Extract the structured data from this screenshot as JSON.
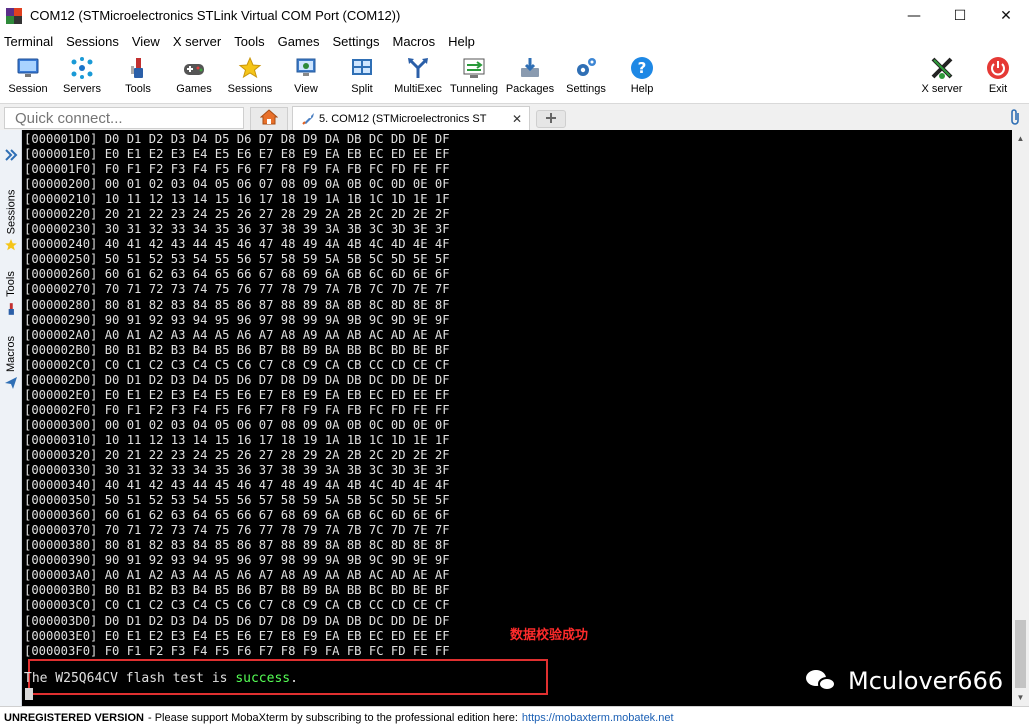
{
  "window": {
    "title": "COM12  (STMicroelectronics STLink Virtual COM Port (COM12))",
    "minimize": "—",
    "maximize": "☐",
    "close": "✕"
  },
  "menu": [
    "Terminal",
    "Sessions",
    "View",
    "X server",
    "Tools",
    "Games",
    "Settings",
    "Macros",
    "Help"
  ],
  "toolbar": [
    {
      "label": "Session",
      "icon": "session-icon"
    },
    {
      "label": "Servers",
      "icon": "servers-icon"
    },
    {
      "label": "Tools",
      "icon": "tools-icon"
    },
    {
      "label": "Games",
      "icon": "games-icon"
    },
    {
      "label": "Sessions",
      "icon": "star-icon"
    },
    {
      "label": "View",
      "icon": "view-icon"
    },
    {
      "label": "Split",
      "icon": "split-icon"
    },
    {
      "label": "MultiExec",
      "icon": "multiexec-icon"
    },
    {
      "label": "Tunneling",
      "icon": "tunneling-icon"
    },
    {
      "label": "Packages",
      "icon": "packages-icon"
    },
    {
      "label": "Settings",
      "icon": "settings-icon"
    },
    {
      "label": "Help",
      "icon": "help-icon"
    },
    {
      "label": "X server",
      "icon": "xserver-icon"
    },
    {
      "label": "Exit",
      "icon": "power-icon"
    }
  ],
  "quick_connect": {
    "placeholder": "Quick connect..."
  },
  "tab": {
    "label": "5. COM12  (STMicroelectronics ST",
    "close": "✕"
  },
  "side_panel": {
    "sessions": "Sessions",
    "tools": "Tools",
    "macros": "Macros"
  },
  "terminal": {
    "lines": [
      "[000001D0] D0 D1 D2 D3 D4 D5 D6 D7 D8 D9 DA DB DC DD DE DF",
      "[000001E0] E0 E1 E2 E3 E4 E5 E6 E7 E8 E9 EA EB EC ED EE EF",
      "[000001F0] F0 F1 F2 F3 F4 F5 F6 F7 F8 F9 FA FB FC FD FE FF",
      "[00000200] 00 01 02 03 04 05 06 07 08 09 0A 0B 0C 0D 0E 0F",
      "[00000210] 10 11 12 13 14 15 16 17 18 19 1A 1B 1C 1D 1E 1F",
      "[00000220] 20 21 22 23 24 25 26 27 28 29 2A 2B 2C 2D 2E 2F",
      "[00000230] 30 31 32 33 34 35 36 37 38 39 3A 3B 3C 3D 3E 3F",
      "[00000240] 40 41 42 43 44 45 46 47 48 49 4A 4B 4C 4D 4E 4F",
      "[00000250] 50 51 52 53 54 55 56 57 58 59 5A 5B 5C 5D 5E 5F",
      "[00000260] 60 61 62 63 64 65 66 67 68 69 6A 6B 6C 6D 6E 6F",
      "[00000270] 70 71 72 73 74 75 76 77 78 79 7A 7B 7C 7D 7E 7F",
      "[00000280] 80 81 82 83 84 85 86 87 88 89 8A 8B 8C 8D 8E 8F",
      "[00000290] 90 91 92 93 94 95 96 97 98 99 9A 9B 9C 9D 9E 9F",
      "[000002A0] A0 A1 A2 A3 A4 A5 A6 A7 A8 A9 AA AB AC AD AE AF",
      "[000002B0] B0 B1 B2 B3 B4 B5 B6 B7 B8 B9 BA BB BC BD BE BF",
      "[000002C0] C0 C1 C2 C3 C4 C5 C6 C7 C8 C9 CA CB CC CD CE CF",
      "[000002D0] D0 D1 D2 D3 D4 D5 D6 D7 D8 D9 DA DB DC DD DE DF",
      "[000002E0] E0 E1 E2 E3 E4 E5 E6 E7 E8 E9 EA EB EC ED EE EF",
      "[000002F0] F0 F1 F2 F3 F4 F5 F6 F7 F8 F9 FA FB FC FD FE FF",
      "[00000300] 00 01 02 03 04 05 06 07 08 09 0A 0B 0C 0D 0E 0F",
      "[00000310] 10 11 12 13 14 15 16 17 18 19 1A 1B 1C 1D 1E 1F",
      "[00000320] 20 21 22 23 24 25 26 27 28 29 2A 2B 2C 2D 2E 2F",
      "[00000330] 30 31 32 33 34 35 36 37 38 39 3A 3B 3C 3D 3E 3F",
      "[00000340] 40 41 42 43 44 45 46 47 48 49 4A 4B 4C 4D 4E 4F",
      "[00000350] 50 51 52 53 54 55 56 57 58 59 5A 5B 5C 5D 5E 5F",
      "[00000360] 60 61 62 63 64 65 66 67 68 69 6A 6B 6C 6D 6E 6F",
      "[00000370] 70 71 72 73 74 75 76 77 78 79 7A 7B 7C 7D 7E 7F",
      "[00000380] 80 81 82 83 84 85 86 87 88 89 8A 8B 8C 8D 8E 8F",
      "[00000390] 90 91 92 93 94 95 96 97 98 99 9A 9B 9C 9D 9E 9F",
      "[000003A0] A0 A1 A2 A3 A4 A5 A6 A7 A8 A9 AA AB AC AD AE AF",
      "[000003B0] B0 B1 B2 B3 B4 B5 B6 B7 B8 B9 BA BB BC BD BE BF",
      "[000003C0] C0 C1 C2 C3 C4 C5 C6 C7 C8 C9 CA CB CC CD CE CF",
      "[000003D0] D0 D1 D2 D3 D4 D5 D6 D7 D8 D9 DA DB DC DD DE DF",
      "[000003E0] E0 E1 E2 E3 E4 E5 E6 E7 E8 E9 EA EB EC ED EE EF",
      "[000003F0] F0 F1 F2 F3 F4 F5 F6 F7 F8 F9 FA FB FC FD FE FF"
    ],
    "annotation": "数据校验成功",
    "result_prefix": "The W25Q64CV flash test is ",
    "result_status": "success",
    "result_suffix": ".",
    "watermark": "Mculover666"
  },
  "status_bar": {
    "unregistered": "UNREGISTERED VERSION",
    "message": " -  Please support MobaXterm by subscribing to the professional edition here: ",
    "link": "https://mobaxterm.mobatek.net"
  },
  "colors": {
    "terminal_bg": "#000000",
    "terminal_fg": "#e0e0e0",
    "success": "#55ff55",
    "annotation": "#ff2b2b",
    "highlight_box": "#e03030"
  }
}
